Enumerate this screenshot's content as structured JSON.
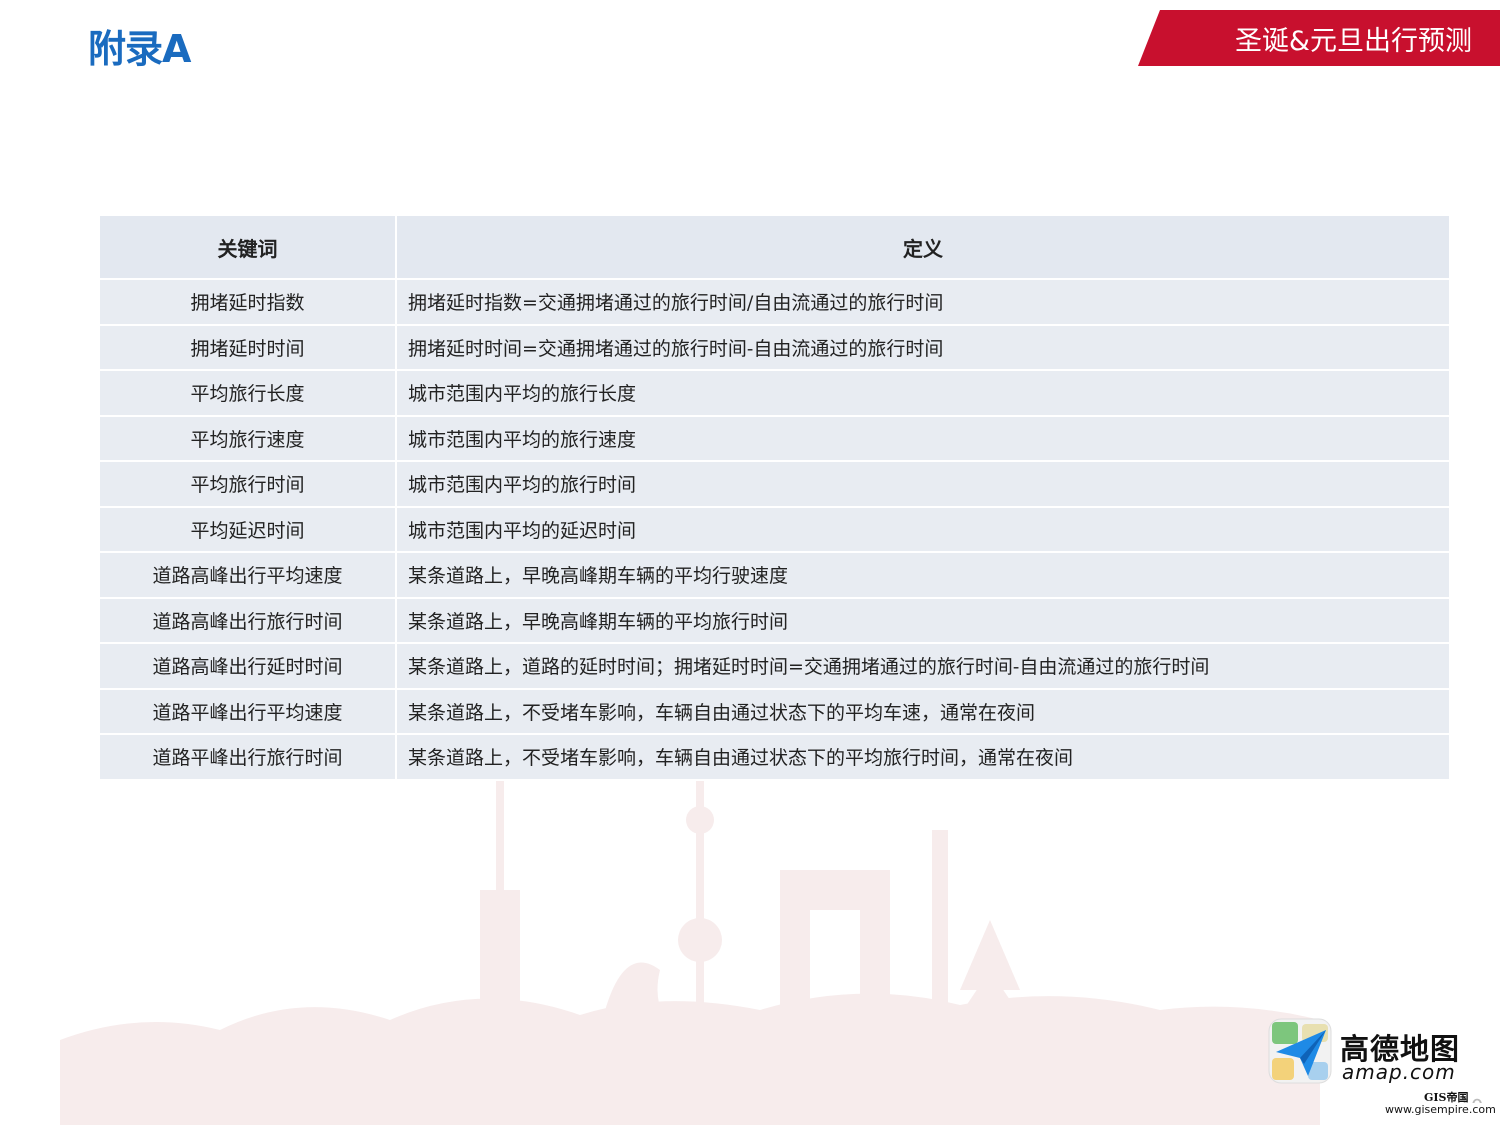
{
  "header": {
    "title": "附录A",
    "banner": "圣诞&元旦出行预测"
  },
  "table": {
    "headers": [
      "关键词",
      "定义"
    ],
    "rows": [
      {
        "keyword": "拥堵延时指数",
        "definition": "拥堵延时指数=交通拥堵通过的旅行时间/自由流通过的旅行时间"
      },
      {
        "keyword": "拥堵延时时间",
        "definition": "拥堵延时时间=交通拥堵通过的旅行时间-自由流通过的旅行时间"
      },
      {
        "keyword": "平均旅行长度",
        "definition": "城市范围内平均的旅行长度"
      },
      {
        "keyword": "平均旅行速度",
        "definition": "城市范围内平均的旅行速度"
      },
      {
        "keyword": "平均旅行时间",
        "definition": "城市范围内平均的旅行时间"
      },
      {
        "keyword": "平均延迟时间",
        "definition": "城市范围内平均的延迟时间"
      },
      {
        "keyword": "道路高峰出行平均速度",
        "definition": "某条道路上，早晚高峰期车辆的平均行驶速度"
      },
      {
        "keyword": "道路高峰出行旅行时间",
        "definition": "某条道路上，早晚高峰期车辆的平均旅行时间"
      },
      {
        "keyword": "道路高峰出行延时时间",
        "definition": "某条道路上，道路的延时时间；拥堵延时时间=交通拥堵通过的旅行时间-自由流通过的旅行时间"
      },
      {
        "keyword": "道路平峰出行平均速度",
        "definition": "某条道路上，不受堵车影响，车辆自由通过状态下的平均车速，通常在夜间"
      },
      {
        "keyword": "道路平峰出行旅行时间",
        "definition": "某条道路上，不受堵车影响，车辆自由通过状态下的平均旅行时间，通常在夜间"
      }
    ]
  },
  "logo": {
    "name_cn": "高德地图",
    "name_en": "amap.com"
  },
  "page_number": "10",
  "watermark": {
    "name": "GIS帝国",
    "url": "www.gisempire.com"
  },
  "colors": {
    "title": "#1a6bbf",
    "banner": "#c8102e",
    "table_bg": "#e8ecf2"
  }
}
